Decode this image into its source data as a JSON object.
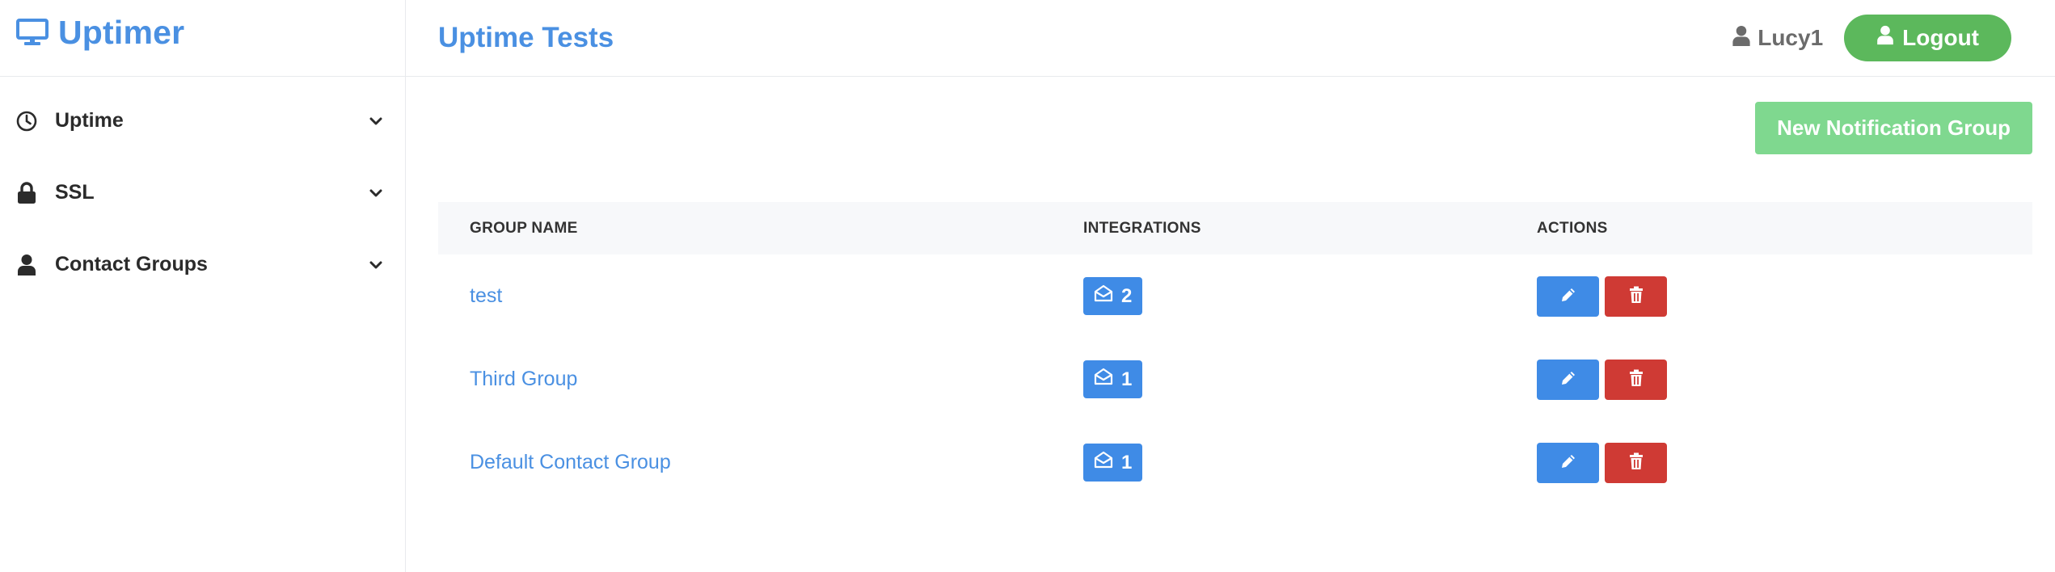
{
  "app": {
    "name": "Uptimer"
  },
  "sidebar": {
    "items": [
      {
        "label": "Uptime",
        "icon": "clock-icon"
      },
      {
        "label": "SSL",
        "icon": "lock-icon"
      },
      {
        "label": "Contact Groups",
        "icon": "user-icon"
      }
    ]
  },
  "header": {
    "title": "Uptime Tests",
    "username": "Lucy1",
    "logout_label": "Logout"
  },
  "toolbar": {
    "new_group_label": "New Notification Group"
  },
  "table": {
    "columns": [
      "GROUP NAME",
      "INTEGRATIONS",
      "ACTIONS"
    ],
    "rows": [
      {
        "name": "test",
        "integrations": "2"
      },
      {
        "name": "Third Group",
        "integrations": "1"
      },
      {
        "name": "Default Contact Group",
        "integrations": "1"
      }
    ]
  },
  "colors": {
    "brand": "#4a90e2",
    "logout": "#5cb85c",
    "new_group": "#7fd88f",
    "edit": "#3f8be6",
    "delete": "#cf3a34"
  }
}
